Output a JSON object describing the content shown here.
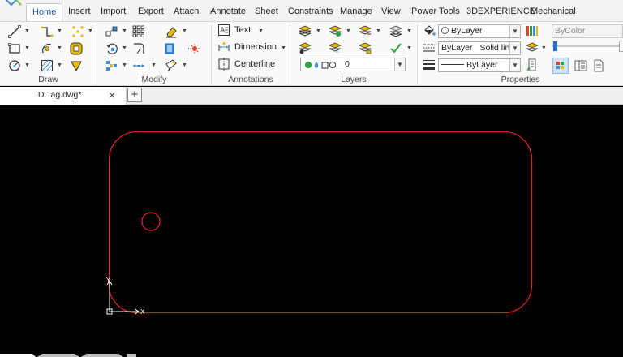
{
  "menu": {
    "tabs": [
      {
        "label": "Home",
        "active": true
      },
      {
        "label": "Insert"
      },
      {
        "label": "Import"
      },
      {
        "label": "Export"
      },
      {
        "label": "Attach"
      },
      {
        "label": "Annotate"
      },
      {
        "label": "Sheet"
      },
      {
        "label": "Constraints"
      },
      {
        "label": "Manage"
      },
      {
        "label": "View"
      },
      {
        "label": "Power Tools"
      },
      {
        "label": "3DEXPERIENCE"
      },
      {
        "label": "Mechanical"
      }
    ]
  },
  "ribbon": {
    "groups": {
      "draw": "Draw",
      "modify": "Modify",
      "annotations": "Annotations",
      "layers": "Layers",
      "properties": "Properties"
    },
    "annotations": {
      "text": "Text",
      "dimension": "Dimension",
      "centerline": "Centerline"
    },
    "layers": {
      "current_layer": "0"
    },
    "properties": {
      "color": "ByLayer",
      "linetype_scope": "ByLayer",
      "linetype": "Solid line",
      "lineweight": "ByLayer",
      "plot_color": "ByColor"
    }
  },
  "document": {
    "tab_label": "ID Tag.dwg*",
    "close_glyph": "×",
    "new_tab_glyph": "+"
  },
  "canvas": {
    "background": "#000000",
    "geometry_color": "#e01f1f",
    "ucs_x_label": "X",
    "ucs_y_label": "Y"
  }
}
